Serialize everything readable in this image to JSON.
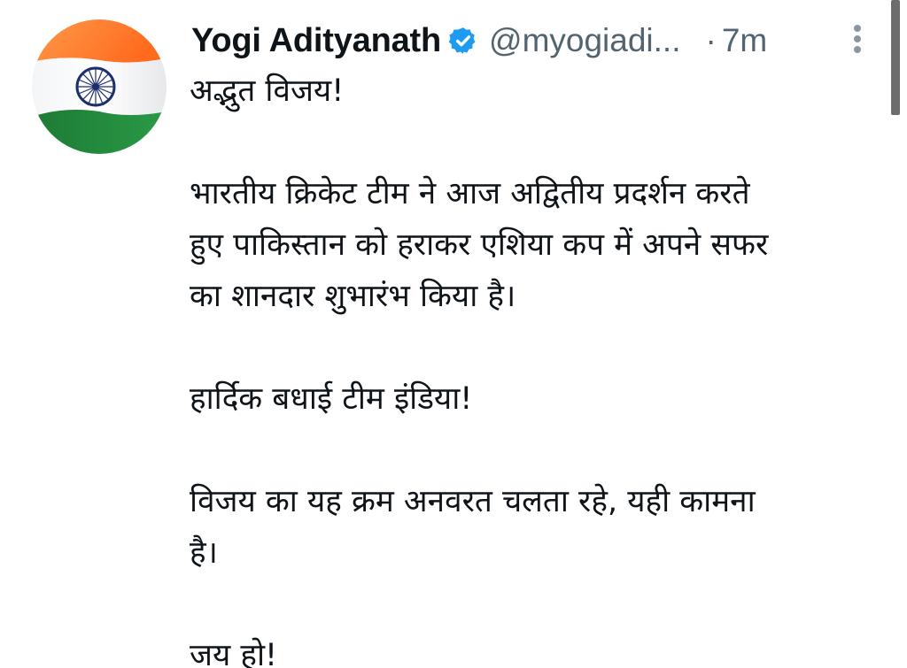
{
  "author": {
    "display_name": "Yogi Adityanath",
    "handle": "@myogiadi...",
    "separator": "·",
    "time": "7m",
    "avatar": "india-flag-avatar",
    "verified_color": "#1d9bf0"
  },
  "menu": {
    "icon": "more-vertical-icon"
  },
  "tweet": {
    "paragraphs": [
      "अद्भुत विजय!",
      "भारतीय क्रिकेट टीम ने आज अद्वितीय प्रदर्शन करते\nहुए पाकिस्तान को हराकर एशिया कप में अपने सफर\nका शानदार शुभारंभ किया है।",
      "हार्दिक बधाई टीम इंडिया!",
      "विजय का यह क्रम अनवरत चलता रहे, यही कामना\nहै।",
      "जय हो!"
    ]
  },
  "colors": {
    "text": "#0f1419",
    "secondary": "#536471",
    "flag_saffron": "#ff7a2e",
    "flag_white": "#ffffff",
    "flag_green": "#1f8a3a",
    "chakra": "#1e2f6e"
  }
}
